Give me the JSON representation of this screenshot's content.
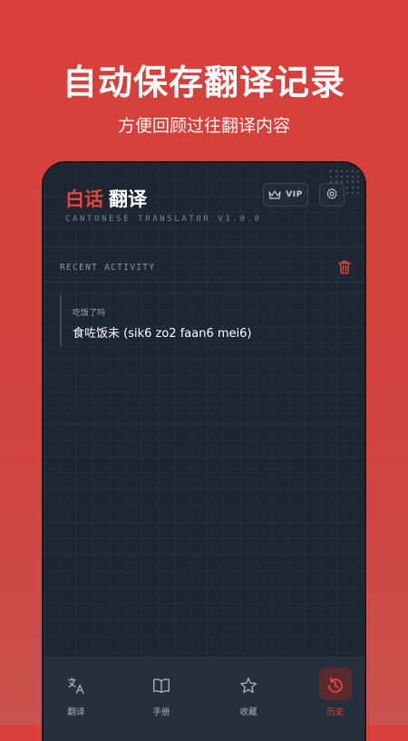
{
  "promo": {
    "title": "自动保存翻译记录",
    "subtitle": "方便回顾过往翻译内容"
  },
  "app": {
    "logo_red": "白话",
    "logo_white": "翻译",
    "tagline": "CANTONESE TRANSLATOR V1.0.0",
    "vip_label": "VIP",
    "vip_icon": "crown-icon",
    "settings_icon": "gear-icon",
    "accent_color": "#e5463f"
  },
  "history": {
    "section_label": "RECENT ACTIVITY",
    "clear_icon": "trash-icon",
    "items": [
      {
        "source": "吃饭了吗",
        "target": "食咗饭未 (sik6 zo2 faan6 mei6)"
      }
    ]
  },
  "nav": {
    "items": [
      {
        "label": "翻译",
        "icon": "translate-icon",
        "active": false
      },
      {
        "label": "手册",
        "icon": "book-icon",
        "active": false
      },
      {
        "label": "收藏",
        "icon": "star-icon",
        "active": false
      },
      {
        "label": "历史",
        "icon": "history-icon",
        "active": true
      }
    ]
  }
}
